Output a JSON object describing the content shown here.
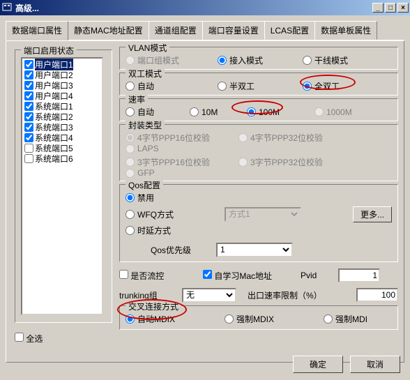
{
  "window": {
    "title": "高级..."
  },
  "tabs": [
    "数据端口属性",
    "静态MAC地址配置",
    "通道组配置",
    "端口容量设置",
    "LCAS配置",
    "数据单板属性"
  ],
  "left": {
    "group_title": "端口启用状态",
    "items": [
      {
        "label": "用户端口1",
        "checked": true,
        "selected": true
      },
      {
        "label": "用户端口2",
        "checked": true
      },
      {
        "label": "用户端口3",
        "checked": true
      },
      {
        "label": "用户端口4",
        "checked": true
      },
      {
        "label": "系统端口1",
        "checked": true
      },
      {
        "label": "系统端口2",
        "checked": true
      },
      {
        "label": "系统端口3",
        "checked": true
      },
      {
        "label": "系统端口4",
        "checked": true
      },
      {
        "label": "系统端口5",
        "checked": false
      },
      {
        "label": "系统端口6",
        "checked": false
      }
    ],
    "select_all": "全选"
  },
  "vlan": {
    "title": "VLAN模式",
    "opts": [
      "端口组模式",
      "接入模式",
      "干线模式"
    ],
    "sel": 1
  },
  "duplex": {
    "title": "双工模式",
    "opts": [
      "自动",
      "半双工",
      "全双工"
    ],
    "sel": 2
  },
  "speed": {
    "title": "速率",
    "opts": [
      "自动",
      "10M",
      "100M",
      "1000M"
    ],
    "sel": 2,
    "disabled_idx": 3
  },
  "encap": {
    "title": "封装类型",
    "rows": [
      [
        "4字节PPP16位校验",
        "4字节PPP32位校验",
        "LAPS"
      ],
      [
        "3字节PPP16位校验",
        "3字节PPP32位校验",
        "GFP"
      ]
    ]
  },
  "qos": {
    "title": "Qos配置",
    "opts": [
      "禁用",
      "WFQ方式",
      "时延方式"
    ],
    "sel": 0,
    "select_val": "方式1",
    "more": "更多...",
    "priority_label": "Qos优先级",
    "priority_val": "1"
  },
  "flow": {
    "flowctrl": "是否流控",
    "autolearn": "自学习Mac地址",
    "pvid_label": "Pvid",
    "pvid_val": "1",
    "trunking_label": "trunking组",
    "trunking_val": "无",
    "ratelimit_label": "出口速率限制（%）",
    "ratelimit_val": "100"
  },
  "cross": {
    "title": "交叉连接方式",
    "opts": [
      "自动MDIX",
      "强制MDIX",
      "强制MDI"
    ],
    "sel": 0
  },
  "buttons": {
    "ok": "确定",
    "cancel": "取消"
  }
}
